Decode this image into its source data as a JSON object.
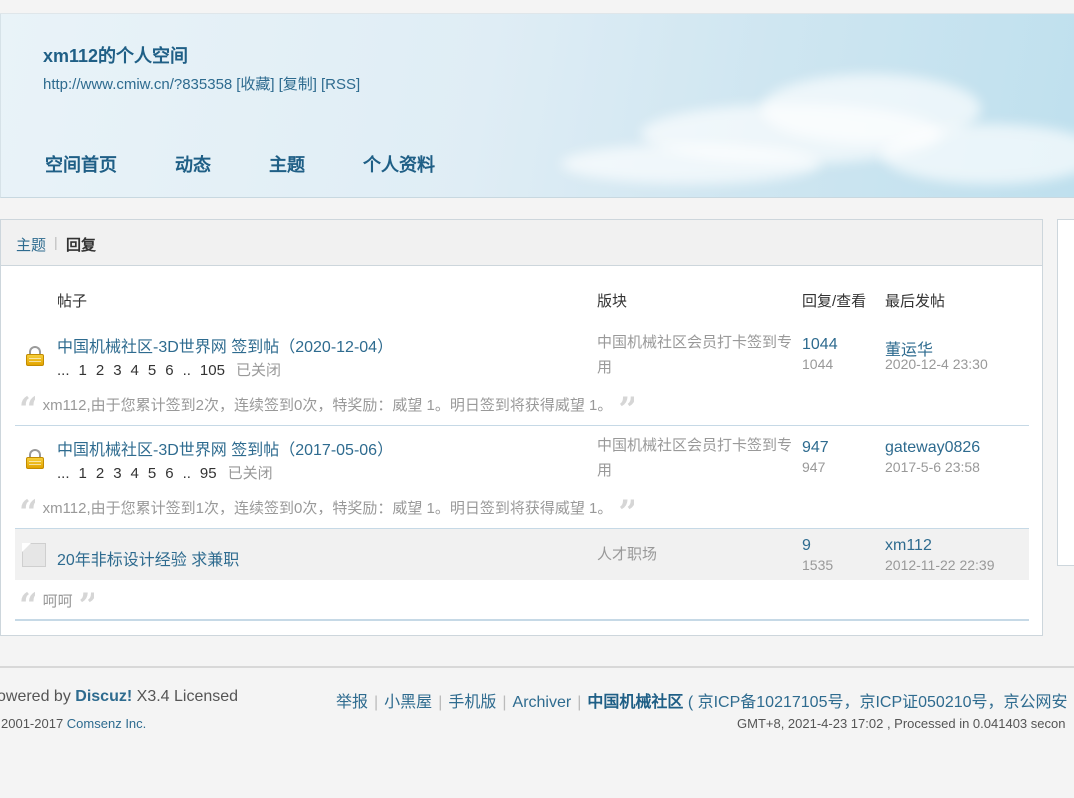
{
  "space": {
    "title": "xm112的个人空间",
    "url": "http://www.cmiw.cn/?835358",
    "actions": [
      "[收藏]",
      "[复制]",
      "[RSS]"
    ]
  },
  "nav": [
    "空间首页",
    "动态",
    "主题",
    "个人资料"
  ],
  "tabs": {
    "topics": "主题",
    "separator": "|",
    "replies": "回复"
  },
  "table": {
    "headers": {
      "thread": "帖子",
      "forum": "版块",
      "replies_views": "回复/查看",
      "last_post": "最后发帖"
    },
    "rows": [
      {
        "icon": "lock-icon",
        "title": "中国机械社区-3D世界网 签到帖（2020-12-04）",
        "pages": [
          "...",
          "1",
          "2",
          "3",
          "4",
          "5",
          "6",
          "..",
          "105"
        ],
        "status": "已关闭",
        "forum": "中国机械社区会员打卡签到专用",
        "replies": "1044",
        "views": "1044",
        "last_user": "董运华",
        "last_time": "2020-12-4 23:30",
        "quote": "xm112,由于您累计签到2次，连续签到0次，特奖励：威望 1。明日签到将获得威望 1。"
      },
      {
        "icon": "lock-icon",
        "title": "中国机械社区-3D世界网 签到帖（2017-05-06）",
        "pages": [
          "...",
          "1",
          "2",
          "3",
          "4",
          "5",
          "6",
          "..",
          "95"
        ],
        "status": "已关闭",
        "forum": "中国机械社区会员打卡签到专用",
        "replies": "947",
        "views": "947",
        "last_user": "gateway0826",
        "last_time": "2017-5-6 23:58",
        "quote": "xm112,由于您累计签到1次，连续签到0次，特奖励：威望 1。明日签到将获得威望 1。"
      },
      {
        "icon": "folder-icon",
        "title": "20年非标设计经验 求兼职",
        "forum": "人才职场",
        "replies": "9",
        "views": "1535",
        "last_user": "xm112",
        "last_time": "2012-11-22 22:39",
        "quote": "呵呵"
      }
    ]
  },
  "footer": {
    "powered_prefix": "owered by",
    "powered_brand": "Discuz!",
    "powered_suffix": "X3.4 Licensed",
    "copyright_prefix": "2001-2017",
    "copyright_brand": "Comsenz Inc.",
    "links": [
      "举报",
      "小黑屋",
      "手机版",
      "Archiver"
    ],
    "site_name": "中国机械社区",
    "icp": "( 京ICP备10217105号，京ICP证050210号，京公网安",
    "time": "GMT+8, 2021-4-23 17:02 , Processed in 0.041403 secon"
  },
  "colors": {
    "link": "#2e6b8f",
    "muted": "#999999",
    "lock": "#e2a400"
  }
}
